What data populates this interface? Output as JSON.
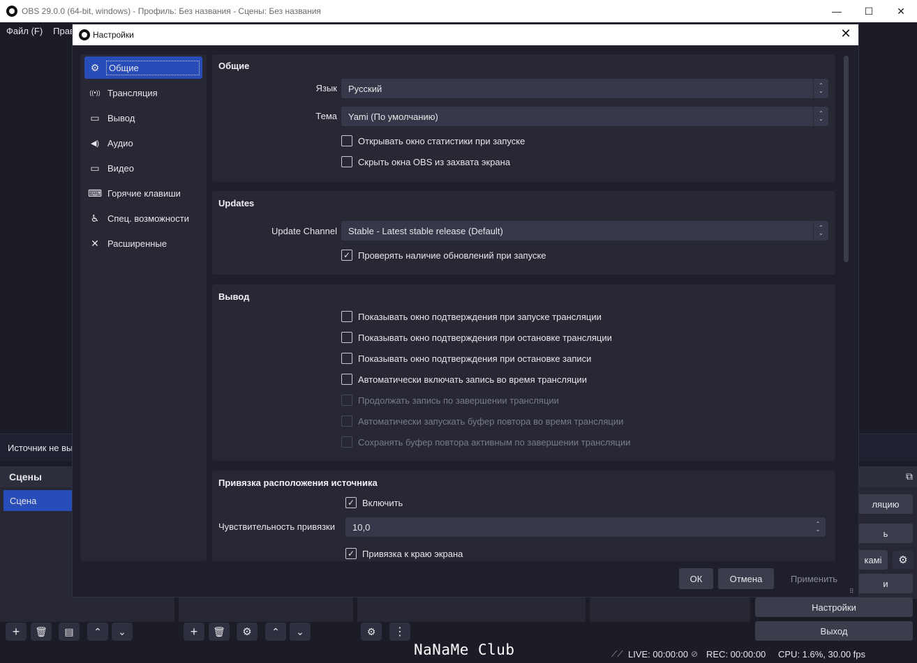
{
  "main_window": {
    "title": "OBS 29.0.0 (64-bit, windows) - Профиль: Без названия - Сцены: Без названия",
    "menu": [
      "Файл (F)",
      "Прав"
    ],
    "controls": {
      "minimize": "—",
      "maximize": "☐",
      "close": "✕"
    }
  },
  "status_strip": {
    "source_text": "Источник не вы"
  },
  "scenes_dock": {
    "title": "Сцены",
    "items": [
      "Сцена"
    ]
  },
  "controls_dock": {
    "partial_labels": [
      "ляцию",
      "ь",
      "камі",
      "и"
    ],
    "settings_label": "Настройки",
    "exit_label": "Выход"
  },
  "bottom_status": {
    "live": "LIVE: 00:00:00",
    "rec": "REC: 00:00:00",
    "cpu": "CPU: 1.6%, 30.00 fps",
    "watermark": "NaNaMe Club"
  },
  "dialog": {
    "title": "Настройки",
    "close": "✕",
    "sidebar": [
      {
        "label": "Общие",
        "icon": "gear-icon",
        "glyph": "⚙"
      },
      {
        "label": "Трансляция",
        "icon": "antenna-icon",
        "glyph": "((•))"
      },
      {
        "label": "Вывод",
        "icon": "output-icon",
        "glyph": "▭"
      },
      {
        "label": "Аудио",
        "icon": "speaker-icon",
        "glyph": "◀)"
      },
      {
        "label": "Видео",
        "icon": "monitor-icon",
        "glyph": "▭"
      },
      {
        "label": "Горячие клавиши",
        "icon": "keyboard-icon",
        "glyph": "⌨"
      },
      {
        "label": "Спец. возможности",
        "icon": "accessibility-icon",
        "glyph": "♿"
      },
      {
        "label": "Расширенные",
        "icon": "tools-icon",
        "glyph": "✕"
      }
    ],
    "general": {
      "title": "Общие",
      "language_label": "Язык",
      "language_value": "Русский",
      "theme_label": "Тема",
      "theme_value": "Yami (По умолчанию)",
      "checks": [
        {
          "label": "Открывать окно статистики при запуске",
          "checked": false
        },
        {
          "label": "Скрыть окна OBS из захвата экрана",
          "checked": false
        }
      ]
    },
    "updates": {
      "title": "Updates",
      "channel_label": "Update Channel",
      "channel_value": "Stable - Latest stable release (Default)",
      "check_label": "Проверять наличие обновлений при запуске",
      "check_checked": true
    },
    "output": {
      "title": "Вывод",
      "checks": [
        {
          "label": "Показывать окно подтверждения при запуске трансляции",
          "checked": false,
          "disabled": false
        },
        {
          "label": "Показывать окно подтверждения при остановке трансляции",
          "checked": false,
          "disabled": false
        },
        {
          "label": "Показывать окно подтверждения при остановке записи",
          "checked": false,
          "disabled": false
        },
        {
          "label": "Автоматически включать запись во время трансляции",
          "checked": false,
          "disabled": false
        },
        {
          "label": "Продолжать запись по завершении трансляции",
          "checked": false,
          "disabled": true
        },
        {
          "label": "Автоматически запускать буфер повтора во время трансляции",
          "checked": false,
          "disabled": true
        },
        {
          "label": "Сохранять буфер повтора активным по завершении трансляции",
          "checked": false,
          "disabled": true
        }
      ]
    },
    "snapping": {
      "title": "Привязка расположения источника",
      "enable_label": "Включить",
      "enable_checked": true,
      "sensitivity_label": "Чувствительность привязки",
      "sensitivity_value": "10,0",
      "screen_edge_label": "Привязка к краю экрана",
      "screen_edge_checked": true
    },
    "buttons": {
      "ok": "ОК",
      "cancel": "Отмена",
      "apply": "Применить"
    }
  }
}
